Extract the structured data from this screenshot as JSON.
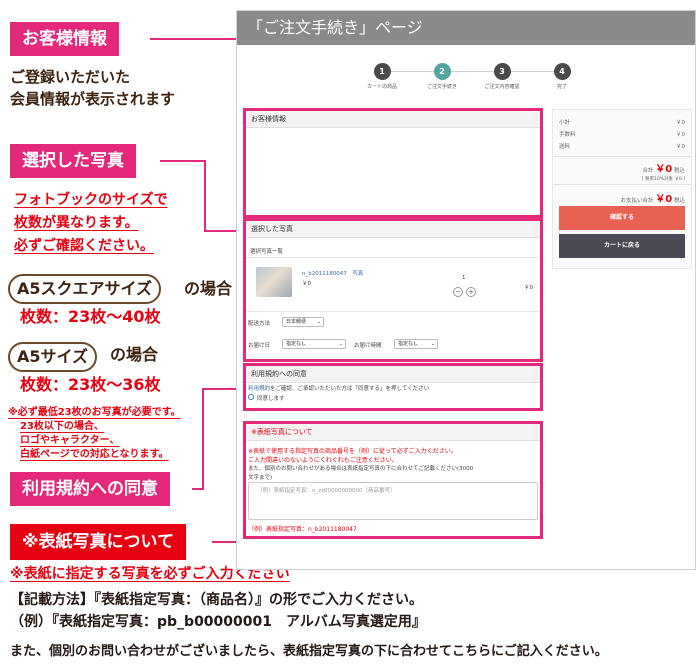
{
  "left": {
    "customer_label": "お客様情報",
    "customer_desc1": "ご登録いただいた",
    "customer_desc2": "会員情報が表示されます",
    "photo_label": "選択した写真",
    "photo_desc1": "フォトブックのサイズで",
    "photo_desc2": "枚数が異なります。",
    "photo_desc3": "必ずご確認ください。",
    "a5sq_pill": "A5スクエアサイズ",
    "a5sq_suffix": "の場合",
    "a5sq_count": "枚数：23枚〜40枚",
    "a5_pill": "A5サイズ",
    "a5_suffix": "の場合",
    "a5_count": "枚数：23枚〜36枚",
    "note1": "※必ず最低23枚のお写真が必要です。",
    "note2": "23枚以下の場合、",
    "note3": "ロゴやキャラクター、",
    "note4": "白紙ページでの対応となります。",
    "terms_label": "利用規約への同意",
    "cover_label": "※表紙写真について"
  },
  "bottom": {
    "cover_warning": "※表紙に指定する写真を必ずご入力ください",
    "method": "【記載方法】『表紙指定写真：（商品名）』の形でご入力ください。",
    "example": "（例）『表紙指定写真：pb_b00000001　アルバム写真選定用』",
    "contact": "また、個別のお問い合わせがございましたら、表紙指定写真の下に合わせてこちらにご記入ください。"
  },
  "shot": {
    "header": "「ご注文手続き」ページ",
    "steps": [
      {
        "num": "1",
        "label": "カートの商品"
      },
      {
        "num": "2",
        "label": "ご注文手続き"
      },
      {
        "num": "3",
        "label": "ご注文内容確認"
      },
      {
        "num": "4",
        "label": "完了"
      }
    ],
    "customer_title": "お客様情報",
    "photos_title": "選択した写真",
    "photos_list": "選択写真一覧",
    "item_name": "n_b2011180047　写真",
    "item_price": "￥0",
    "item_qty": "1",
    "item_total": "￥0",
    "delivery_method_label": "配送方法",
    "delivery_method_value": "日本郵便",
    "delivery_date_label": "お届け日",
    "delivery_date_value": "指定なし",
    "delivery_time_label": "お届け時間",
    "delivery_time_value": "指定なし",
    "terms_title": "利用規約への同意",
    "terms_text_link": "利用規約",
    "terms_text": "をご確認、ご承認いただいた方は「同意する」を押してください",
    "terms_radio": "同意します",
    "cover_title": "※表紙写真について",
    "cover_line1": "※表紙で使用する指定写真の商品番号を（例）に従って必ずご入力ください。",
    "cover_line2": "ご入力間違いのないようにくれぐれもご注意ください。",
    "cover_line3": "また、個別のお問い合わせがある場合は表紙指定写真の下に合わせてご記載ください(3000",
    "cover_line4": "文字まで)",
    "cover_placeholder": "（例）表紙指定写真：n_zs00000000000（商品番号）",
    "cover_example": "（例）表紙指定写真：n_b2011180047",
    "summary": {
      "subtotal_label": "小計",
      "subtotal_value": "￥0",
      "fee_label": "手数料",
      "fee_value": "￥0",
      "shipping_label": "送料",
      "shipping_value": "￥0",
      "total_label": "合計",
      "total_value": "￥0",
      "total_tax": "税込",
      "tax_note": "[ 税率10%対象 ￥0 ]",
      "pay_label": "お支払い合計",
      "pay_value": "￥0",
      "pay_tax": "税込",
      "confirm_button": "確認する",
      "back_button": "カートに戻る"
    }
  }
}
